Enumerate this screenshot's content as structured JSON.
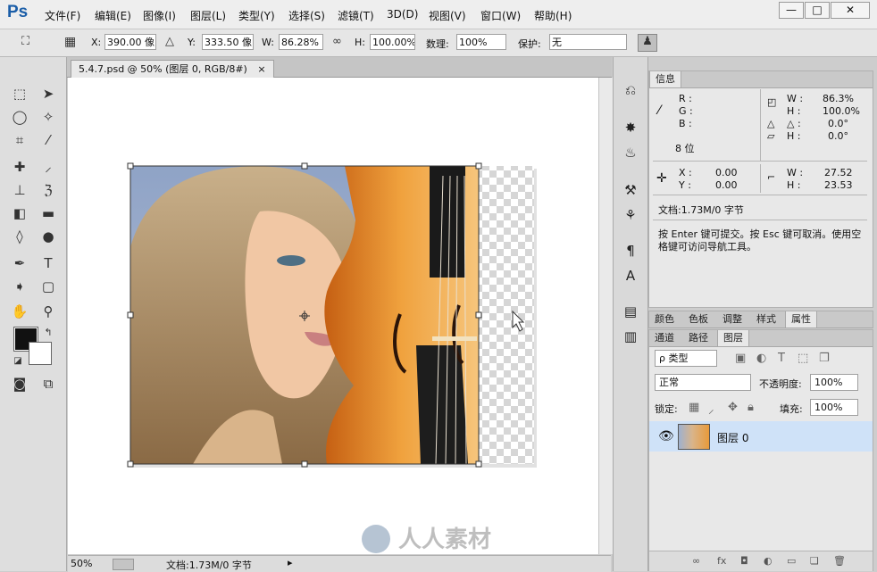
{
  "app": {
    "logo": "Ps"
  },
  "menu": [
    "文件(F)",
    "编辑(E)",
    "图像(I)",
    "图层(L)",
    "类型(Y)",
    "选择(S)",
    "滤镜(T)",
    "3D(D)",
    "视图(V)",
    "窗口(W)",
    "帮助(H)"
  ],
  "window_controls": {
    "minimize": "—",
    "maximize": "□",
    "close": "✕"
  },
  "options": {
    "x_label": "X:",
    "x_value": "390.00 像",
    "y_label": "Y:",
    "y_value": "333.50 像",
    "w_label": "W:",
    "w_value": "86.28%",
    "h_label": "H:",
    "h_value": "100.00%",
    "angle_label": "数理:",
    "angle_value": "100%",
    "warp_label": "保护:",
    "warp_value": "无"
  },
  "document": {
    "tab_title": "5.4.7.psd @ 50% (图层 0, RGB/8#)",
    "close": "×"
  },
  "status": {
    "zoom": "50%",
    "doc_info": "文档:1.73M/0 字节"
  },
  "info_panel": {
    "tab": "信息",
    "r_label": "R :",
    "g_label": "G :",
    "b_label": "B :",
    "bit_label": "8 位",
    "w_label": "W :",
    "w_value": "86.3%",
    "h_label": "H :",
    "h_value": "100.0%",
    "a_label": "△ :",
    "a_value": "0.0°",
    "h2_label": "H :",
    "h2_value": "0.0°",
    "x_label": "X :",
    "x_value": "0.00",
    "y_label": "Y :",
    "y_value": "0.00",
    "sw_label": "W :",
    "sw_value": "27.52",
    "sh_label": "H :",
    "sh_value": "23.53",
    "doc_info": "文档:1.73M/0 字节",
    "hint": "按 Enter 键可提交。按 Esc 键可取消。使用空格键可访问导航工具。"
  },
  "adjust_tabs": [
    "颜色",
    "色板",
    "调整",
    "样式",
    "属性"
  ],
  "layers_panel": {
    "tabs": [
      "通道",
      "路径",
      "图层"
    ],
    "filter_kind": "ρ 类型",
    "blend_mode": "正常",
    "opacity_label": "不透明度:",
    "opacity_value": "100%",
    "lock_label": "锁定:",
    "fill_label": "填充:",
    "fill_value": "100%",
    "layer_name": "图层 0"
  },
  "watermark": "人人素材",
  "colors": {
    "accent": "#1b5ea8",
    "selected_layer": "#cfe2f8"
  }
}
